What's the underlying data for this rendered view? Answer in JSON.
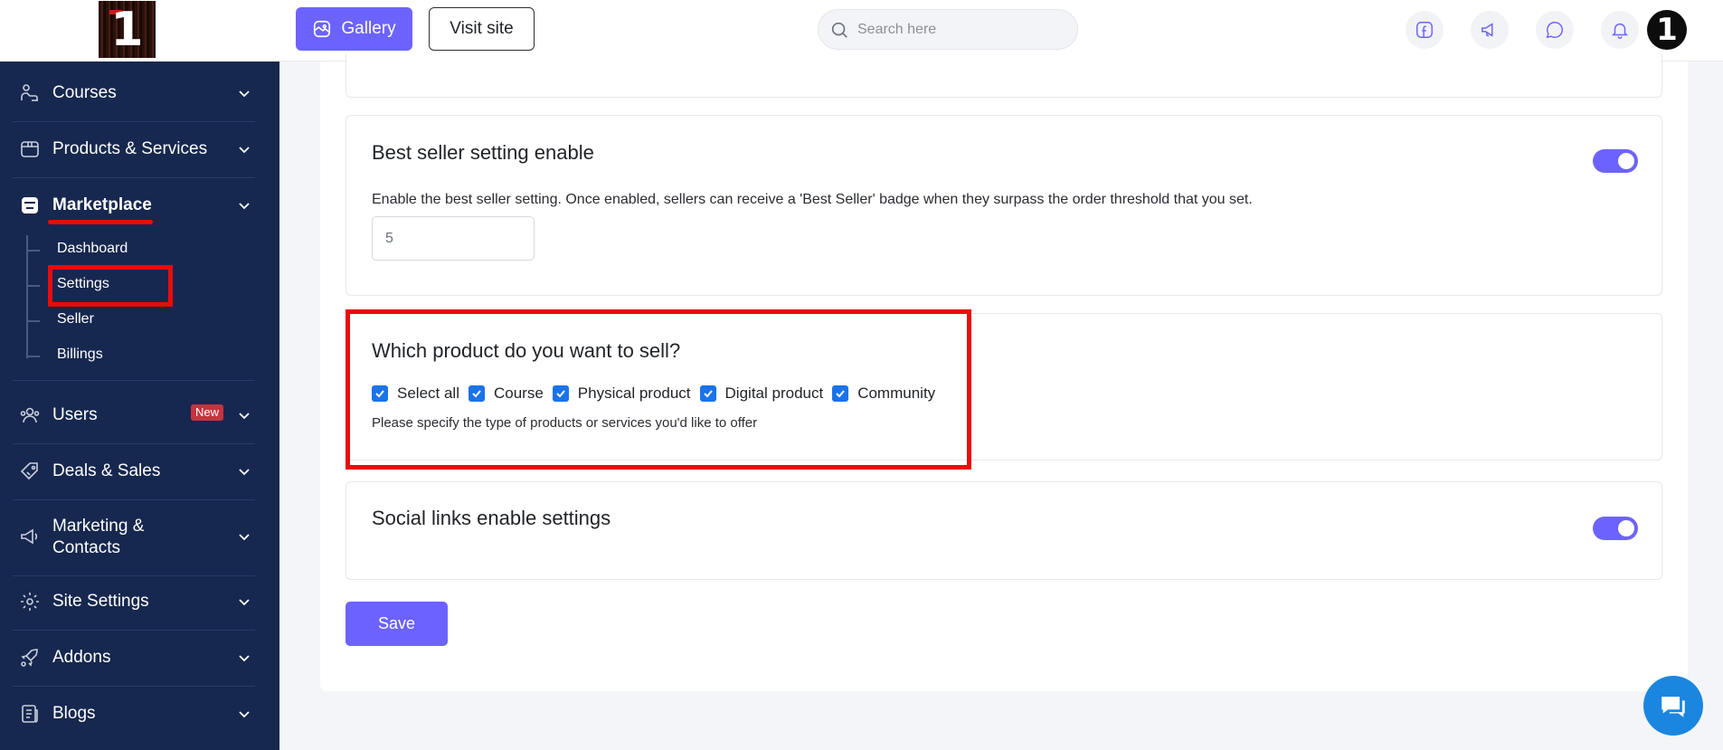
{
  "sidebar": {
    "items": [
      {
        "label": "Courses",
        "icon": "courses-icon"
      },
      {
        "label": "Products & Services",
        "icon": "box-icon"
      },
      {
        "label": "Marketplace",
        "icon": "store-icon"
      },
      {
        "label": "Users",
        "icon": "users-icon",
        "badge": "New"
      },
      {
        "label": "Deals & Sales",
        "icon": "tag-icon"
      },
      {
        "label": "Marketing &",
        "label2": "Contacts",
        "icon": "megaphone-icon"
      },
      {
        "label": "Site Settings",
        "icon": "gear-icon"
      },
      {
        "label": "Addons",
        "icon": "rocket-icon"
      },
      {
        "label": "Blogs",
        "icon": "document-icon"
      }
    ],
    "marketplace_sub": [
      {
        "label": "Dashboard"
      },
      {
        "label": "Settings"
      },
      {
        "label": "Seller"
      },
      {
        "label": "Billings"
      }
    ]
  },
  "header": {
    "gallery_label": "Gallery",
    "visit_label": "Visit site",
    "search_placeholder": "Search here",
    "avatar_text": "1"
  },
  "logo_text": "1",
  "sections": {
    "best_seller": {
      "title": "Best seller setting enable",
      "description": "Enable the best seller setting. Once enabled, sellers can receive a 'Best Seller' badge when they surpass the order threshold that you set.",
      "threshold_value": "5",
      "enabled": true
    },
    "product_types": {
      "title": "Which product do you want to sell?",
      "options": [
        {
          "label": "Select all",
          "checked": true
        },
        {
          "label": "Course",
          "checked": true
        },
        {
          "label": "Physical product",
          "checked": true
        },
        {
          "label": "Digital product",
          "checked": true
        },
        {
          "label": "Community",
          "checked": true
        }
      ],
      "help": "Please specify the type of products or services you'd like to offer"
    },
    "social_links": {
      "title": "Social links enable settings",
      "enabled": true
    }
  },
  "save_label": "Save",
  "colors": {
    "sidebar_bg": "#16284f",
    "accent": "#6c63ff",
    "highlight": "#ea0b0b",
    "checkbox": "#1a73e8"
  }
}
